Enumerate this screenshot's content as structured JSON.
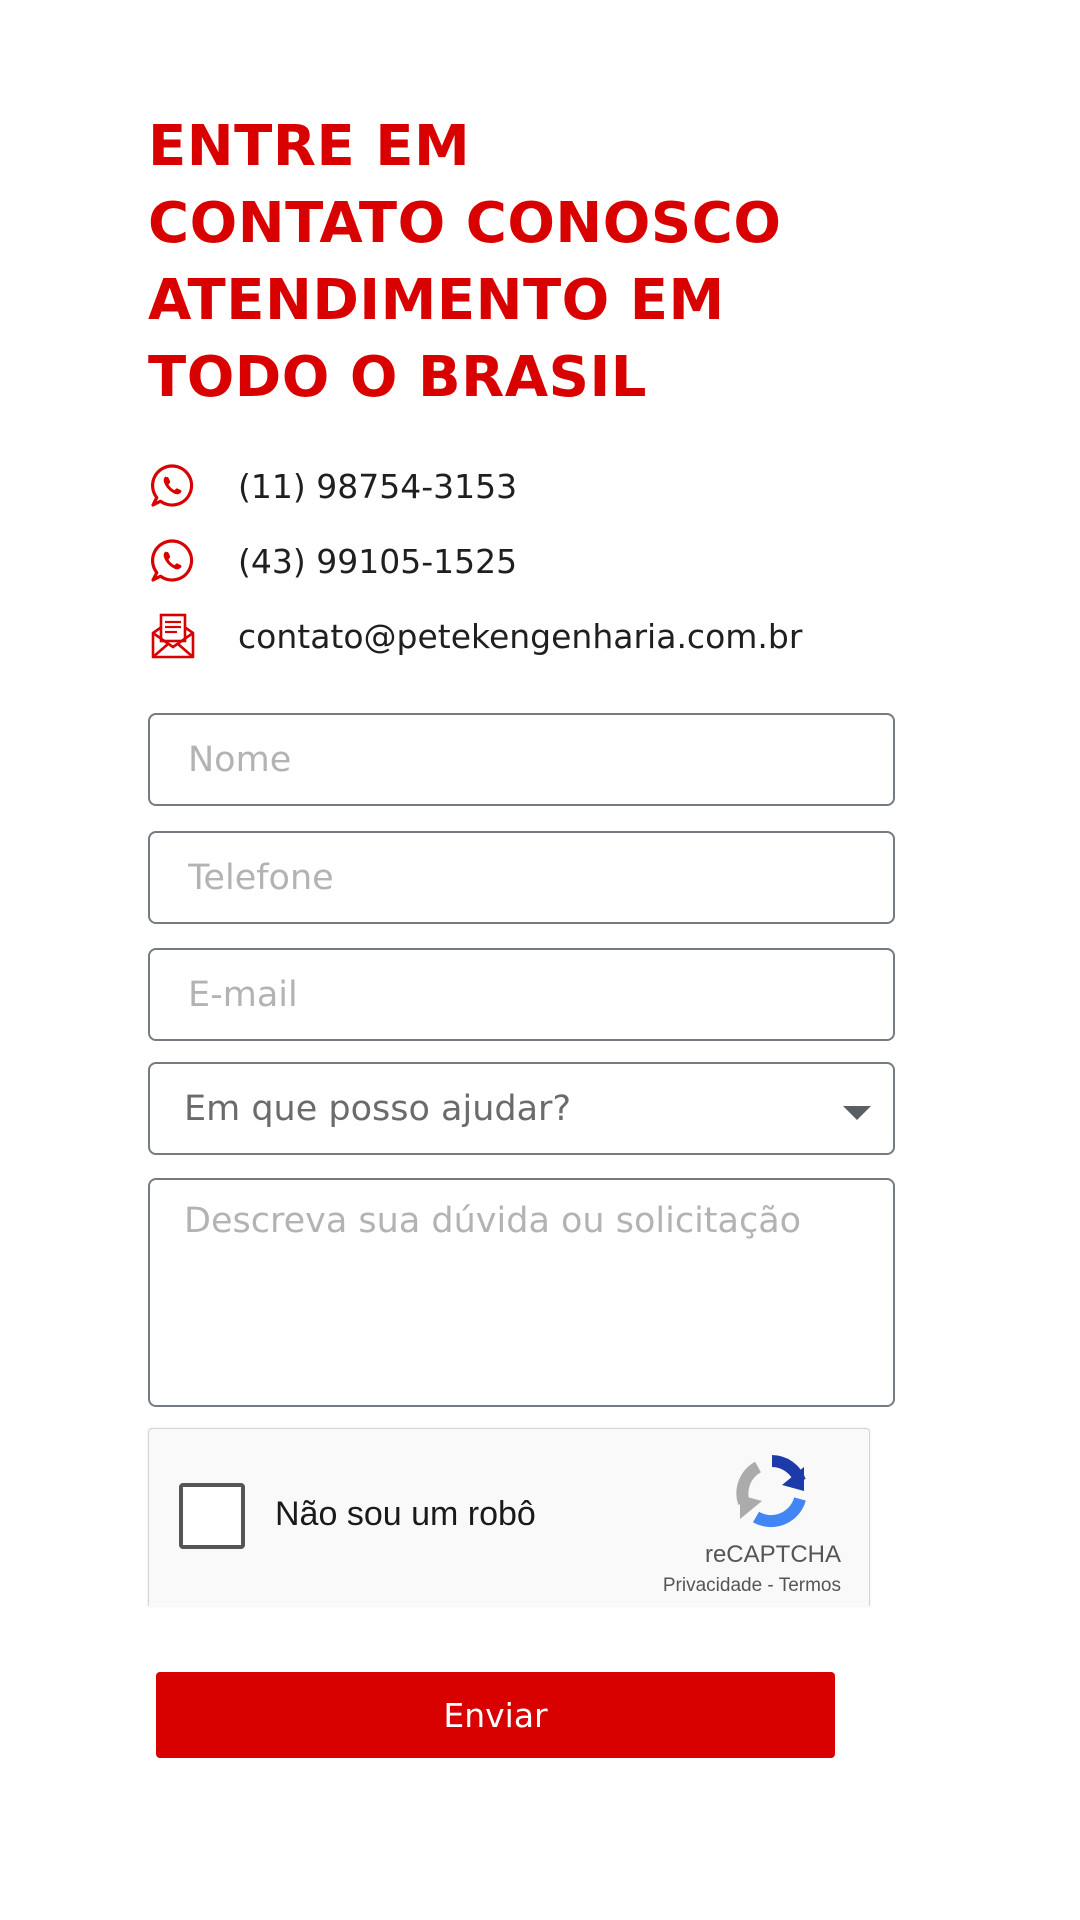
{
  "heading": {
    "line1": "ENTRE EM",
    "line2": "CONTATO CONOSCO",
    "line3": "ATENDIMENTO EM",
    "line4": "TODO O BRASIL"
  },
  "contacts": [
    {
      "icon": "whatsapp-icon",
      "text": "(11) 98754-3153"
    },
    {
      "icon": "whatsapp-icon",
      "text": "(43) 99105-1525"
    },
    {
      "icon": "email-icon",
      "text": "contato@petekengenharia.com.br"
    }
  ],
  "form": {
    "name_placeholder": "Nome",
    "phone_placeholder": "Telefone",
    "email_placeholder": "E-mail",
    "subject_selected": "Em que posso ajudar?",
    "message_placeholder": "Descreva sua dúvida ou solicitação",
    "submit_label": "Enviar"
  },
  "recaptcha": {
    "label": "Não sou um robô",
    "brand": "reCAPTCHA",
    "privacy": "Privacidade",
    "separator": " - ",
    "terms": "Termos"
  },
  "colors": {
    "accent": "#d90000",
    "field_border": "#757b82",
    "placeholder": "#b3b3b3"
  }
}
